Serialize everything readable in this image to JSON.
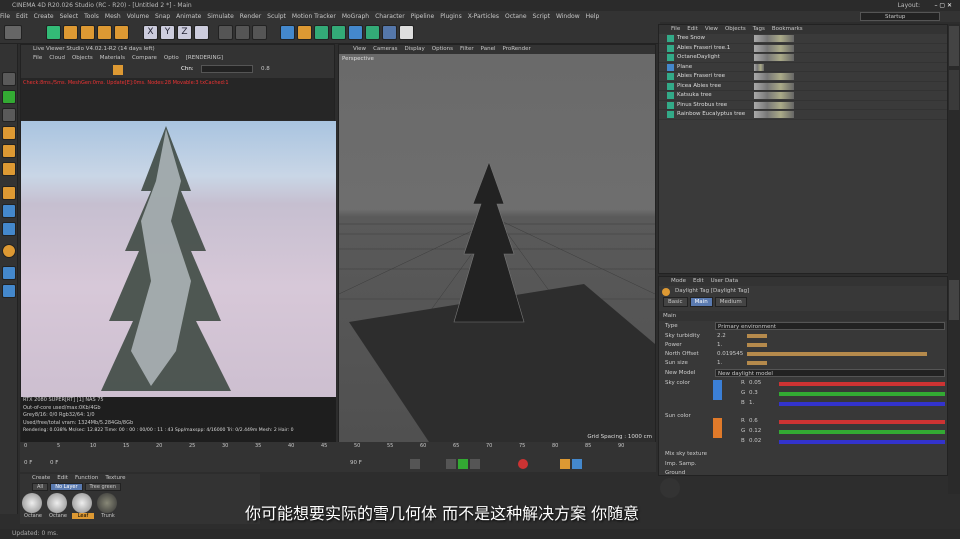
{
  "window": {
    "title": "CINEMA 4D R20.026 Studio (RC - R20) - [Untitled 2 *] - Main",
    "layout_label": "Layout:",
    "layout_value": "Startup"
  },
  "menu": [
    "File",
    "Edit",
    "Create",
    "Select",
    "Tools",
    "Mesh",
    "Volume",
    "Snap",
    "Animate",
    "Simulate",
    "Render",
    "Sculpt",
    "Motion Tracker",
    "MoGraph",
    "Character",
    "Pipeline",
    "Plugins",
    "X-Particles",
    "Octane",
    "Script",
    "Window",
    "Help"
  ],
  "live_viewer": {
    "title": "Live Viewer Studio V4.02.1-R2 (14 days left)",
    "menu": [
      "File",
      "Cloud",
      "Objects",
      "Materials",
      "Compare",
      "Optio"
    ],
    "status": "[RENDERING]",
    "chnl": "Chn:",
    "chnl_val": "0.8",
    "info": "Check:8ms./5ms. MeshGen:0ms. Update[E]:0ms. Nodes:28 Movable:3 txCached:1",
    "gpu": "RTX 2080 SUPER[RT] [1]",
    "gpu_temp": "75",
    "gpu_load": "NAS",
    "ooc": "Out-of-core used/max:0Kb/4Gb",
    "grey": "Grey8/16: 0/0",
    "rgb": "Rgb32/64: 1/0",
    "vram": "Used/free/total vram: 1324Mb/5.284Gb/8Gb",
    "render_line": "Rendering: 0.038%  Ms/sec: 12.822  Time: 00 : 00 : 00/00 : 11 : 43  Spp/maxspp: 4/16000  Tri: 0/2.449m  Mesh: 2  Hair: 0"
  },
  "viewport": {
    "menu": [
      "View",
      "Cameras",
      "Display",
      "Options",
      "Filter",
      "Panel",
      "ProRender"
    ],
    "label": "Perspective",
    "grid": "Grid Spacing : 1000 cm"
  },
  "object_manager": {
    "menu": [
      "File",
      "Edit",
      "View",
      "Objects",
      "Tags",
      "Bookmarks"
    ],
    "objects": [
      "Tree Snow",
      "Abies Fraseri tree.1",
      "OctaneDaylight",
      "Plane",
      "Abies Fraseri tree",
      "Picea Abies tree",
      "Katsuka tree",
      "Pinus Strobus tree",
      "Rainbow Eucalyptus tree"
    ]
  },
  "attributes": {
    "menu": [
      "Mode",
      "Edit",
      "User Data"
    ],
    "tag_title": "Daylight Tag [Daylight Tag]",
    "tabs": [
      "Basic",
      "Main",
      "Medium"
    ],
    "section": "Main",
    "rows": [
      {
        "label": "Type",
        "value": "Primary environment"
      },
      {
        "label": "Sky turbidity",
        "value": "2.2"
      },
      {
        "label": "Power",
        "value": "1."
      },
      {
        "label": "North Offset",
        "value": "0.019545"
      },
      {
        "label": "Sun size",
        "value": "1."
      },
      {
        "label": "New Model",
        "value": "New daylight model"
      },
      {
        "label": "Sky color",
        "value": ""
      },
      {
        "label": "Sun color",
        "value": ""
      },
      {
        "label": "Mix sky texture",
        "value": ""
      },
      {
        "label": "Imp. Samp.",
        "value": ""
      },
      {
        "label": "Ground",
        "value": ""
      }
    ],
    "sky_rgb": {
      "R": "0.05",
      "G": "0.3",
      "B": "1."
    },
    "sun_rgb": {
      "R": "0.6",
      "G": "0.12",
      "B": "0.02"
    }
  },
  "timeline": {
    "ticks": [
      "0",
      "5",
      "10",
      "15",
      "20",
      "25",
      "30",
      "35",
      "40",
      "45",
      "50",
      "55",
      "60",
      "65",
      "70",
      "75",
      "80",
      "85",
      "90"
    ],
    "frame": "0 F",
    "start": "0 F",
    "end": "90 F"
  },
  "materials": {
    "menu": [
      "Create",
      "Edit",
      "Function",
      "Texture"
    ],
    "filters": [
      "All",
      "No Layer",
      "Tree green"
    ],
    "items": [
      "Octane",
      "Octane",
      "Leaf",
      "Trunk"
    ]
  },
  "status": "Updated: 0 ms.",
  "subtitle": "你可能想要实际的雪几何体 而不是这种解决方案 你随意"
}
